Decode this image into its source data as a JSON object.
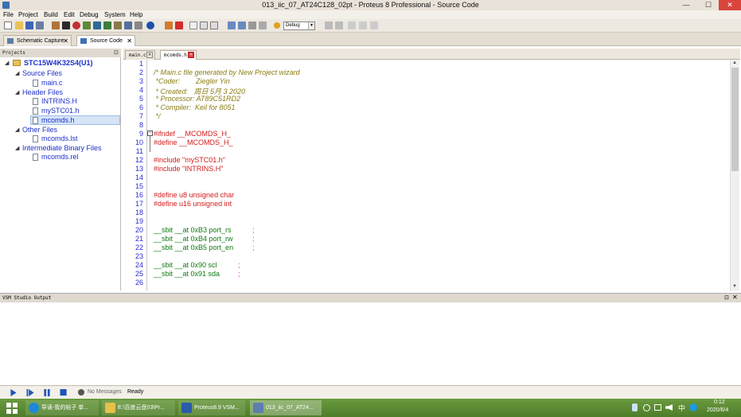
{
  "window": {
    "title": "013_iic_07_AT24C128_02pt - Proteus 8 Professional - Source Code",
    "minimize": "—",
    "maximize": "☐",
    "close": "✕"
  },
  "menu": [
    "File",
    "Project",
    "Build",
    "Edit",
    "Debug",
    "System",
    "Help"
  ],
  "toolbar": {
    "build_config": "Debug"
  },
  "top_tabs": [
    {
      "label": "Schematic Capture",
      "close": "✕"
    },
    {
      "label": "Source Code",
      "close": "✕"
    }
  ],
  "projects": {
    "header": "Projects",
    "root": "STC15W4K32S4(U1)",
    "groups": [
      {
        "label": "Source Files",
        "files": [
          "main.c"
        ]
      },
      {
        "label": "Header Files",
        "files": [
          "INTRINS.H",
          "mySTC01.h",
          "mcomds.h"
        ]
      },
      {
        "label": "Other Files",
        "files": [
          "mcomds.lst"
        ]
      },
      {
        "label": "Intermediate Binary Files",
        "files": [
          "mcomds.rel"
        ]
      }
    ]
  },
  "editor": {
    "tabs": [
      {
        "label": "main.c"
      },
      {
        "label": "mcomds.h"
      }
    ],
    "line_numbers": [
      "1",
      "2",
      "3",
      "4",
      "5",
      "6",
      "7",
      "8",
      "9",
      "10",
      "11",
      "12",
      "13",
      "14",
      "15",
      "16",
      "17",
      "18",
      "19",
      "20",
      "21",
      "22",
      "23",
      "24",
      "25",
      "26"
    ],
    "lines": {
      "l2": "/* Main.c file generated by New Project wizard",
      "l3": " *Coder:        Ziegler Yin",
      "l4": " * Created:   周日 5月 3 2020",
      "l5": " * Processor: AT89C51RD2",
      "l6": " * Compiler:  Keil for 8051",
      "l7": " */",
      "l9": "#ifndef __MCOMDS_H_",
      "l10": "#define __MCOMDS_H_",
      "l12": "#include \"mySTC01.h\"",
      "l13": "#include \"INTRINS.H\"",
      "l16": "#define u8 unsigned char",
      "l17": "#define u16 unsigned int",
      "l20a": "__sbit __at 0xB3 port_rs",
      "l21a": "__sbit __at 0xB4 port_rw",
      "l22a": "__sbit __at 0xB5 port_en",
      "l24a": "__sbit __at 0x90 scl",
      "l25a": "__sbit __at 0x91 sda",
      "semi": ";"
    }
  },
  "output": {
    "header": "VSM Studio Output"
  },
  "status": {
    "messages": "No Messages",
    "state": "Ready"
  },
  "taskbar": {
    "items": [
      "导读-我的帖子 单...",
      "E:\\百度云盘03\\Pr...",
      "Proteus8.9 VSM...",
      "013_iic_07_AT24..."
    ],
    "ime": "中",
    "time": "0:12",
    "date": "2020/6/4"
  }
}
